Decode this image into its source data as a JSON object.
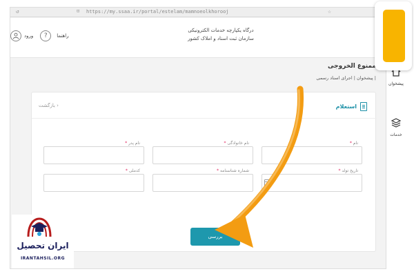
{
  "browser": {
    "url": "https://my.ssaa.ir/portal/estelam/mamnoeolkhorooj",
    "back_icon": "back-arrow-icon",
    "star_icon": "star-icon"
  },
  "header": {
    "brand_line1": "درگاه یکپارچه خدمات الکترونیکی",
    "brand_line2": "سازمان ثبت اسناد و املاک کشور",
    "help_label": "راهنما",
    "help_icon": "?",
    "login_label": "ورود",
    "login_icon": "user-icon"
  },
  "page": {
    "title": "ممنوع الخروجی",
    "breadcrumb": "پیشخوان | اجرای اسناد رسمی |"
  },
  "card": {
    "header_label": "استعلام",
    "back_label": "بازگشت ›"
  },
  "form": {
    "first_name": "نام",
    "last_name": "نام خانوادگی",
    "father_name": "نام پدر",
    "birth_date": "تاریخ تولد",
    "id_number": "شماره شناسنامه",
    "national_code": "کدملی",
    "required_mark": "*"
  },
  "actions": {
    "search_label": "بررسی"
  },
  "sidebar": {
    "items": [
      {
        "label": "پیشخوان",
        "icon": "home-icon"
      },
      {
        "label": "خدمات",
        "icon": "layers-icon"
      }
    ]
  },
  "overlay": {
    "logo_text": "ایران تحصیل",
    "logo_url": "IRANTAHSIL.ORG",
    "accent_color": "#f8b400",
    "arrow_color": "#f39c12",
    "button_color": "#1e98ad"
  }
}
